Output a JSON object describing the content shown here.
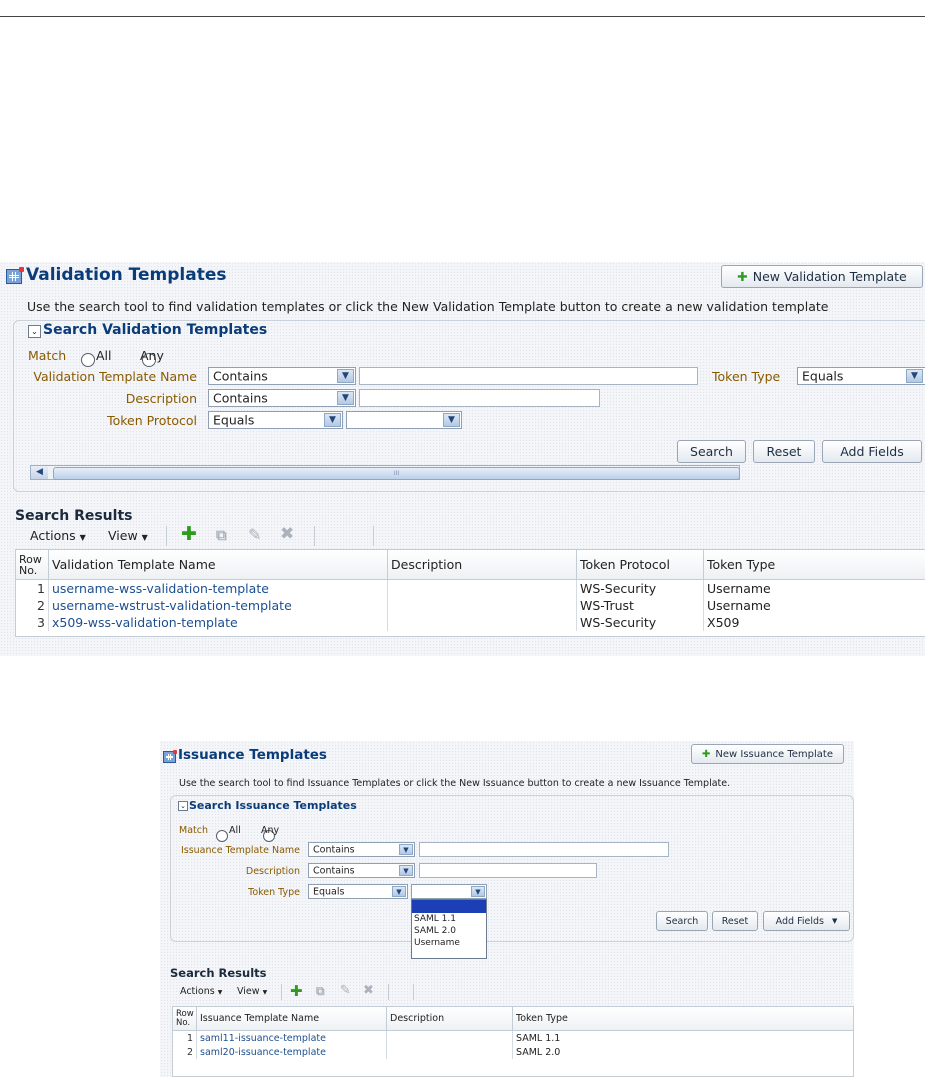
{
  "validation": {
    "title": "Validation Templates",
    "new_button": "New Validation Template",
    "instruction": "Use the search tool to find validation templates or click the New Validation Template button to create a new validation template",
    "search_title": "Search Validation Templates",
    "match_label": "Match",
    "match_all": "All",
    "match_any": "Any",
    "fields": {
      "name_label": "Validation Template Name",
      "name_op": "Contains",
      "name_value": "",
      "desc_label": "Description",
      "desc_op": "Contains",
      "desc_value": "",
      "protocol_label": "Token Protocol",
      "protocol_op": "Equals",
      "protocol_value": "",
      "type_label": "Token Type",
      "type_op": "Equals"
    },
    "buttons": {
      "search": "Search",
      "reset": "Reset",
      "add_fields": "Add Fields"
    },
    "scrollbar_grip": "III",
    "results_title": "Search Results",
    "actions_label": "Actions",
    "view_label": "View",
    "columns": [
      "Row No.",
      "Validation Template Name",
      "Description",
      "Token Protocol",
      "Token Type"
    ],
    "col_row_a": "Row",
    "col_row_b": "No.",
    "rows": [
      {
        "no": "1",
        "name": "username-wss-validation-template",
        "desc": "",
        "protocol": "WS-Security",
        "type": "Username"
      },
      {
        "no": "2",
        "name": "username-wstrust-validation-template",
        "desc": "",
        "protocol": "WS-Trust",
        "type": "Username"
      },
      {
        "no": "3",
        "name": "x509-wss-validation-template",
        "desc": "",
        "protocol": "WS-Security",
        "type": "X509"
      }
    ]
  },
  "issuance": {
    "title": "Issuance Templates",
    "new_button": "New Issuance Template",
    "instruction": "Use the search tool to find Issuance Templates or click the New Issuance button to create a new Issuance Template.",
    "search_title": "Search Issuance Templates",
    "match_label": "Match",
    "match_all": "All",
    "match_any": "Any",
    "fields": {
      "name_label": "Issuance Template Name",
      "name_op": "Contains",
      "name_value": "",
      "desc_label": "Description",
      "desc_op": "Contains",
      "desc_value": "",
      "type_label": "Token Type",
      "type_op": "Equals",
      "type_value": ""
    },
    "dropdown_options": [
      "",
      "SAML 1.1",
      "SAML 2.0",
      "Username"
    ],
    "buttons": {
      "search": "Search",
      "reset": "Reset",
      "add_fields": "Add Fields"
    },
    "results_title": "Search Results",
    "actions_label": "Actions",
    "view_label": "View",
    "columns": [
      "Row No.",
      "Issuance Template Name",
      "Description",
      "Token Type"
    ],
    "col_row_a": "Row",
    "col_row_b": "No.",
    "rows": [
      {
        "no": "1",
        "name": "saml11-issuance-template",
        "desc": "",
        "type": "SAML 1.1"
      },
      {
        "no": "2",
        "name": "saml20-issuance-template",
        "desc": "",
        "type": "SAML 2.0"
      }
    ]
  },
  "colors": {
    "title": "#0b3c7a",
    "label": "#8a5a00",
    "link": "#1d4f8f",
    "add": "#2d9c1e",
    "panel_bg": "#f3f5f8"
  }
}
